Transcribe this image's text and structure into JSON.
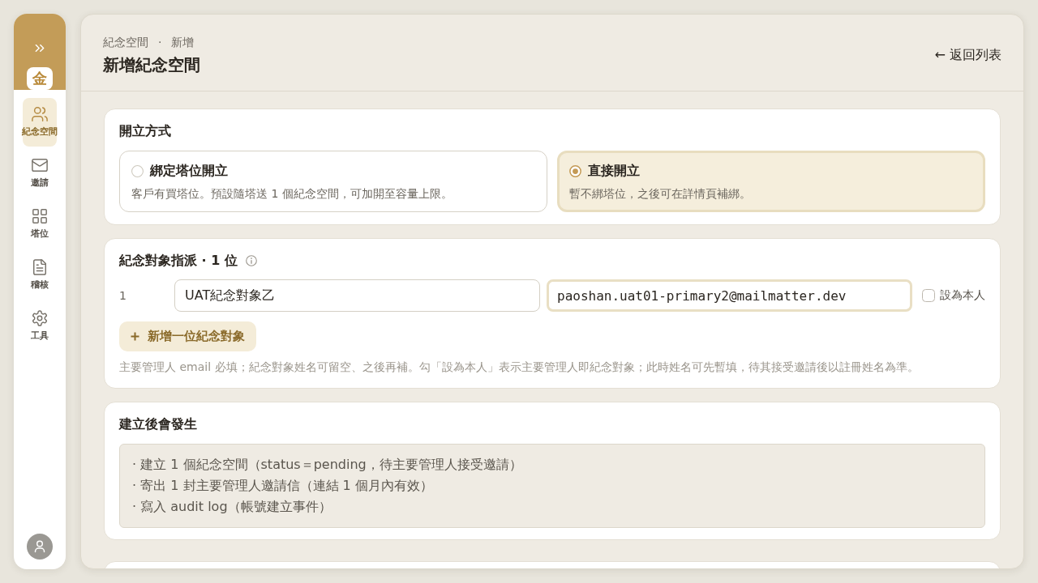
{
  "sidebar": {
    "logo": "金",
    "nav_items": [
      {
        "label": "紀念空間",
        "selected": true
      },
      {
        "label": "邀請",
        "selected": false
      },
      {
        "label": "塔位",
        "selected": false
      },
      {
        "label": "稽核",
        "selected": false
      },
      {
        "label": "工具",
        "selected": false
      }
    ]
  },
  "header": {
    "breadcrumb": [
      "紀念空間",
      "新增"
    ],
    "breadcrumb_separator": "·",
    "title": "新增紀念空間",
    "back_link": "← 返回列表"
  },
  "creation_method": {
    "title": "開立方式",
    "options": [
      {
        "label": "綁定塔位開立",
        "description": "客戶有買塔位。預設隨塔送 1 個紀念空間，可加開至容量上限。",
        "selected": false
      },
      {
        "label": "直接開立",
        "description": "暫不綁塔位，之後可在詳情頁補綁。",
        "selected": true
      }
    ]
  },
  "assignment": {
    "title": "紀念對象指派 · 1 位",
    "rows": [
      {
        "number": "1",
        "name": "UAT紀念對象乙",
        "email": "paoshan.uat01-primary2@mailmatter.dev",
        "email_focused": true,
        "self_label": "設為本人",
        "self_checked": false
      }
    ],
    "add_button": "新增一位紀念對象",
    "hint": "主要管理人 email 必填；紀念對象姓名可留空、之後再補。勾「設為本人」表示主要管理人即紀念對象；此時姓名可先暫填，待其接受邀請後以註冊姓名為準。"
  },
  "effects": {
    "title": "建立後會發生",
    "lines": [
      "· 建立 1 個紀念空間（status＝pending，待主要管理人接受邀請）",
      "· 寄出 1 封主要管理人邀請信（連結 1 個月內有效）",
      "· 寫入 audit log（帳號建立事件）"
    ]
  }
}
